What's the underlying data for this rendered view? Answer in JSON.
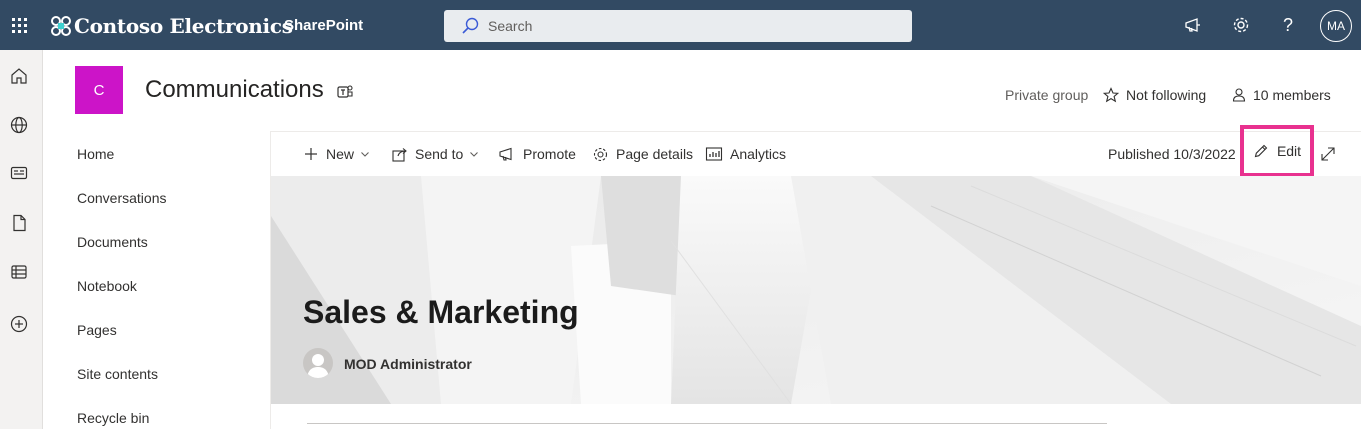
{
  "suite_bar": {
    "brand": "Contoso Electronics",
    "app": "SharePoint",
    "search_placeholder": "Search",
    "user_initials": "MA",
    "icons": [
      "waffle-icon",
      "megaphone-icon",
      "gear-icon",
      "help-icon"
    ],
    "bg_color": "#324a63"
  },
  "app_bar": {
    "icons": [
      "home-icon",
      "globe-icon",
      "news-icon",
      "file-icon",
      "list-icon",
      "add-icon"
    ]
  },
  "site": {
    "logo_letter": "C",
    "logo_color": "#cc14c8",
    "title": "Communications",
    "privacy": "Private group",
    "follow": "Not following",
    "members": "10 members"
  },
  "nav": {
    "items": [
      "Home",
      "Conversations",
      "Documents",
      "Notebook",
      "Pages",
      "Site contents",
      "Recycle bin"
    ]
  },
  "command_bar": {
    "new": "New",
    "send_to": "Send to",
    "promote": "Promote",
    "page_details": "Page details",
    "analytics": "Analytics",
    "published": "Published 10/3/2022",
    "edit": "Edit",
    "highlight_color": "#e8318f"
  },
  "hero": {
    "title": "Sales & Marketing",
    "author": "MOD Administrator"
  }
}
